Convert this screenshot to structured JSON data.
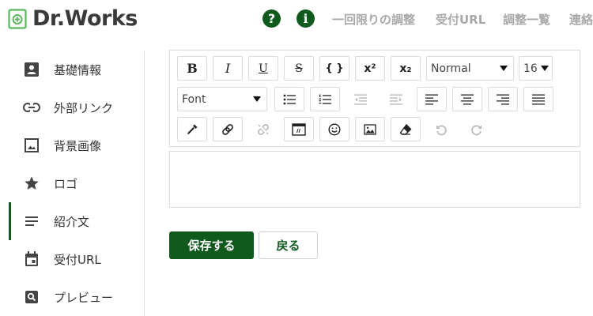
{
  "header": {
    "logo_text": "Dr.Works",
    "help_glyph": "?",
    "info_glyph": "i",
    "nav": [
      {
        "label": "一回限りの調整"
      },
      {
        "label": "受付URL"
      },
      {
        "label": "調整一覧"
      },
      {
        "label": "連絡"
      }
    ]
  },
  "sidebar": {
    "items": [
      {
        "label": "基礎情報",
        "icon": "account-box-icon"
      },
      {
        "label": "外部リンク",
        "icon": "link-icon"
      },
      {
        "label": "背景画像",
        "icon": "image-icon"
      },
      {
        "label": "ロゴ",
        "icon": "star-icon"
      },
      {
        "label": "紹介文",
        "icon": "notes-icon",
        "active": true
      },
      {
        "label": "受付URL",
        "icon": "calendar-icon"
      },
      {
        "label": "プレビュー",
        "icon": "search-icon"
      }
    ]
  },
  "toolbar": {
    "bold": "B",
    "italic": "I",
    "underline": "U",
    "strike": "S",
    "code": "{ }",
    "superscript": "x²",
    "subscript": "x₂",
    "block_format": "Normal",
    "font_size": "16",
    "font_family": "Font"
  },
  "actions": {
    "save_label": "保存する",
    "back_label": "戻る"
  },
  "colors": {
    "brand": "#0f5a1c",
    "logo_mark": "#5cb85c"
  }
}
